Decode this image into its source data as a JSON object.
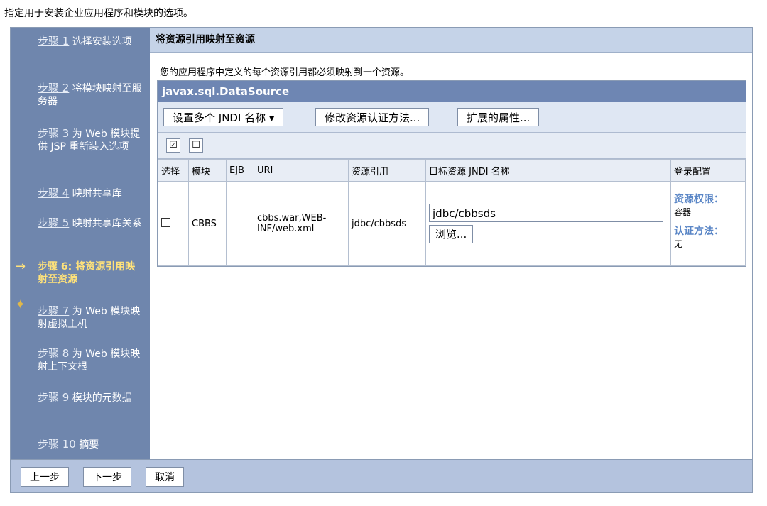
{
  "intro": "指定用于安装企业应用程序和模块的选项。",
  "steps": [
    {
      "num": "步骤 1",
      "label": "选择安装选项"
    },
    {
      "num": "步骤 2",
      "label": "将模块映射至服务器"
    },
    {
      "num": "步骤 3",
      "label": "为 Web 模块提供 JSP 重新装入选项"
    },
    {
      "num": "步骤 4",
      "label": "映射共享库"
    },
    {
      "num": "步骤 5",
      "label": "映射共享库关系"
    },
    {
      "num": "步骤 6:",
      "label": "将资源引用映射至资源"
    },
    {
      "num": "步骤 7",
      "label": "为 Web 模块映射虚拟主机"
    },
    {
      "num": "步骤 8",
      "label": "为 Web 模块映射上下文根"
    },
    {
      "num": "步骤 9",
      "label": "模块的元数据"
    },
    {
      "num": "步骤 10",
      "label": "摘要"
    }
  ],
  "main": {
    "title": "将资源引用映射至资源",
    "description": "您的应用程序中定义的每个资源引用都必须映射到一个资源。",
    "panel_title": "javax.sql.DataSource",
    "toolbar": {
      "set_jndi": "设置多个 JNDI 名称 ▾",
      "modify_auth": "修改资源认证方法...",
      "extended_props": "扩展的属性..."
    },
    "columns": [
      "选择",
      "模块",
      "EJB",
      "URI",
      "资源引用",
      "目标资源 JNDI 名称",
      "登录配置"
    ],
    "row": {
      "module": "CBBS",
      "ejb": "",
      "uri": "cbbs.war,WEB-INF/web.xml",
      "resource_ref": "jdbc/cbbsds",
      "jndi_value": "jdbc/cbbsds",
      "browse": "浏览...",
      "auth_perm_label": "资源权限：",
      "auth_perm_value": "容器",
      "auth_method_label": "认证方法：",
      "auth_method_value": "无"
    }
  },
  "footer": {
    "prev": "上一步",
    "next": "下一步",
    "cancel": "取消"
  }
}
